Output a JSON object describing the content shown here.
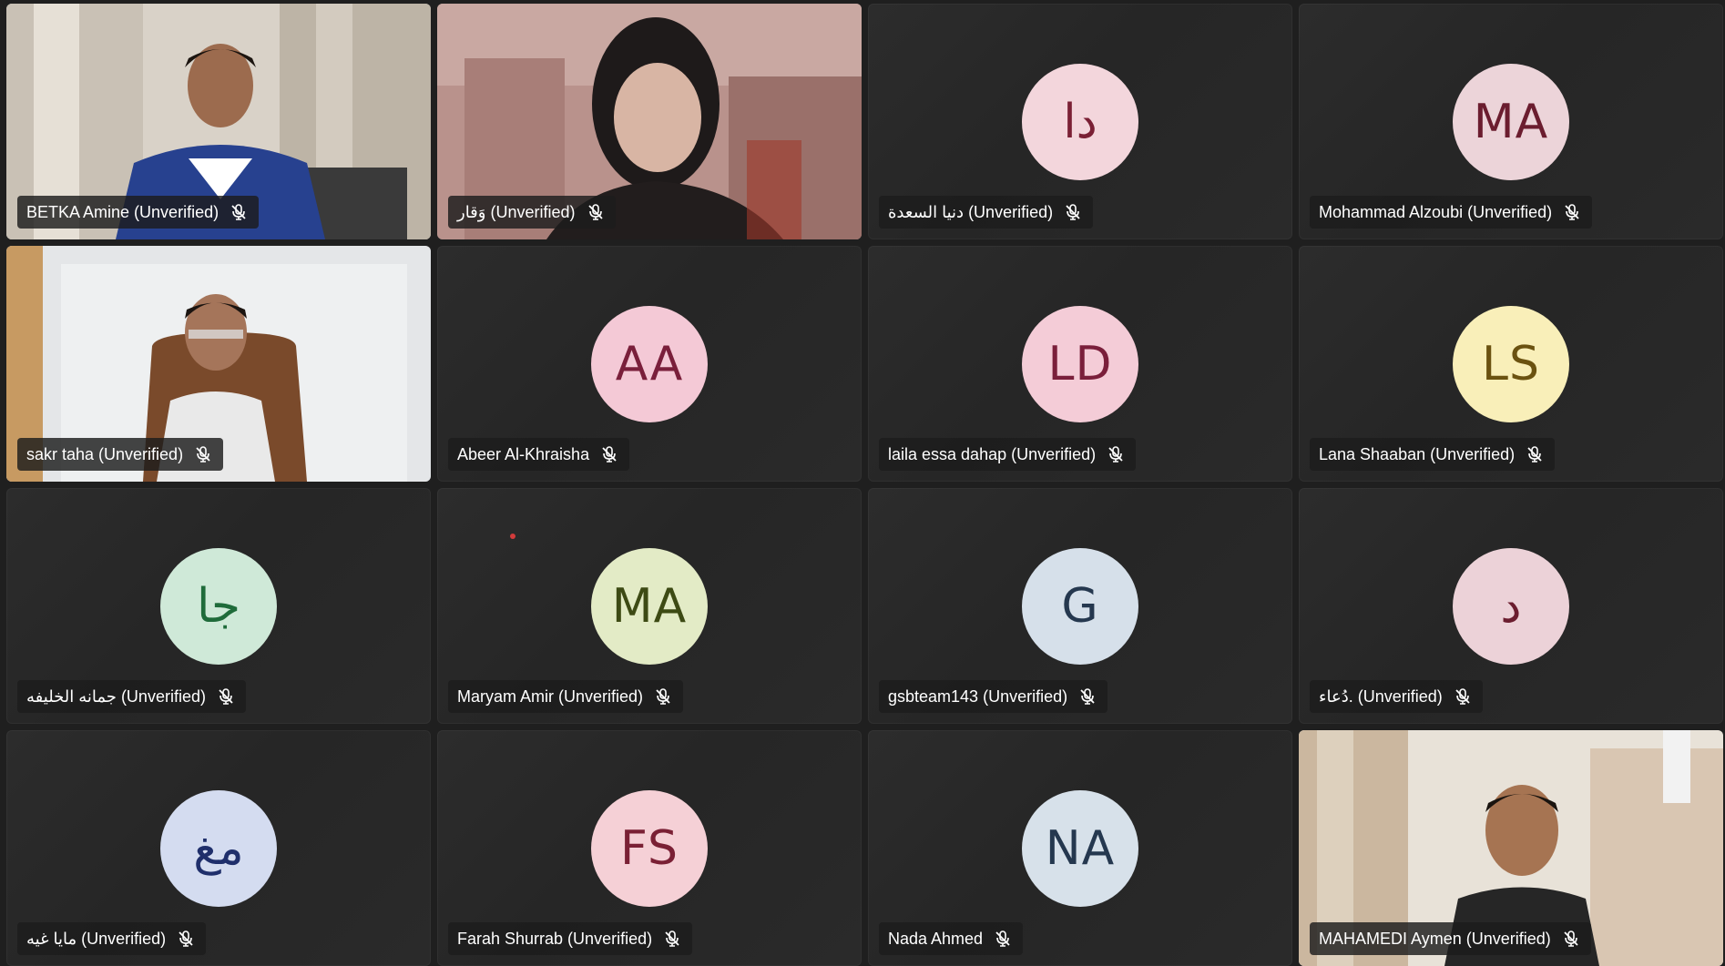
{
  "participants": [
    {
      "name": "BETKA Amine (Unverified)",
      "type": "video",
      "muted": true
    },
    {
      "name": "وَقار (Unverified)",
      "type": "video",
      "muted": true
    },
    {
      "name": "دنيا السعدة (Unverified)",
      "type": "avatar",
      "initials": "دا",
      "avatar_bg": "#f3d6dc",
      "avatar_fg": "#7a2035",
      "muted": true
    },
    {
      "name": "Mohammad Alzoubi (Unverified)",
      "type": "avatar",
      "initials": "MA",
      "avatar_bg": "#ecd4d9",
      "avatar_fg": "#6b1d2f",
      "muted": true
    },
    {
      "name": "sakr taha (Unverified)",
      "type": "video",
      "muted": true
    },
    {
      "name": "Abeer Al-Khraisha",
      "type": "avatar",
      "initials": "AA",
      "avatar_bg": "#f4c9d6",
      "avatar_fg": "#7a1f3b",
      "muted": true
    },
    {
      "name": "laila essa dahap (Unverified)",
      "type": "avatar",
      "initials": "LD",
      "avatar_bg": "#f4ccd7",
      "avatar_fg": "#7a1f3b",
      "muted": true
    },
    {
      "name": "Lana Shaaban (Unverified)",
      "type": "avatar",
      "initials": "LS",
      "avatar_bg": "#f9efb9",
      "avatar_fg": "#6b5210",
      "muted": true
    },
    {
      "name": "جمانه الخليفه (Unverified)",
      "type": "avatar",
      "initials": "جا",
      "avatar_bg": "#cfe9d8",
      "avatar_fg": "#1f6b3a",
      "muted": true
    },
    {
      "name": "Maryam Amir (Unverified)",
      "type": "avatar",
      "initials": "MA",
      "avatar_bg": "#e3ebc6",
      "avatar_fg": "#3d4a14",
      "muted": true
    },
    {
      "name": "gsbteam143 (Unverified)",
      "type": "avatar",
      "initials": "G",
      "avatar_bg": "#d6e0ea",
      "avatar_fg": "#25384f",
      "muted": true
    },
    {
      "name": "دُعاء. (Unverified)",
      "type": "avatar",
      "initials": "د",
      "avatar_bg": "#ecd2d8",
      "avatar_fg": "#6b1d2f",
      "muted": true
    },
    {
      "name": "مايا غيه (Unverified)",
      "type": "avatar",
      "initials": "مغ",
      "avatar_bg": "#d4dcf0",
      "avatar_fg": "#1f2f6b",
      "muted": true
    },
    {
      "name": "Farah Shurrab (Unverified)",
      "type": "avatar",
      "initials": "FS",
      "avatar_bg": "#f5d0d6",
      "avatar_fg": "#7a2035",
      "muted": true
    },
    {
      "name": "Nada Ahmed",
      "type": "avatar",
      "initials": "NA",
      "avatar_bg": "#d7e1ea",
      "avatar_fg": "#25384f",
      "muted": true
    },
    {
      "name": "MAHAMEDI Aymen (Unverified)",
      "type": "video",
      "muted": true
    }
  ],
  "icons": {
    "mic": "mic-off-icon"
  }
}
